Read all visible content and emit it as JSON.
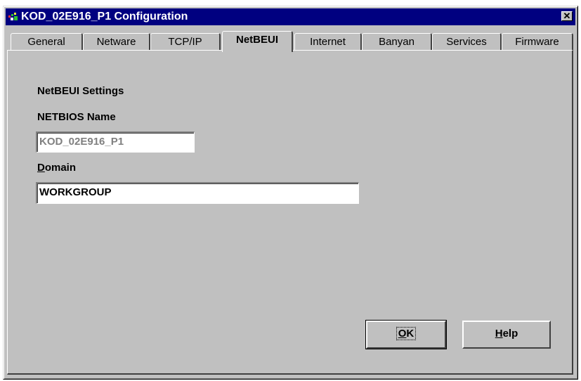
{
  "window": {
    "title": "KOD_02E916_P1 Configuration",
    "close_glyph": "✕"
  },
  "tabs": [
    {
      "label": "General",
      "active": false
    },
    {
      "label": "Netware",
      "active": false
    },
    {
      "label": "TCP/IP",
      "active": false
    },
    {
      "label": "NetBEUI",
      "active": true
    },
    {
      "label": "Internet",
      "active": false
    },
    {
      "label": "Banyan",
      "active": false
    },
    {
      "label": "Services",
      "active": false
    },
    {
      "label": "Firmware",
      "active": false
    }
  ],
  "panel": {
    "section_title": "NetBEUI Settings",
    "netbios_label": "NETBIOS Name",
    "netbios_value": "KOD_02E916_P1",
    "domain_label_first": "D",
    "domain_label_rest": "omain",
    "domain_value": "WORKGROUP"
  },
  "buttons": {
    "ok_first": "O",
    "ok_rest": "K",
    "help_first": "H",
    "help_rest": "elp"
  },
  "colors": {
    "titlebar": "#000080",
    "face": "#c0c0c0"
  }
}
